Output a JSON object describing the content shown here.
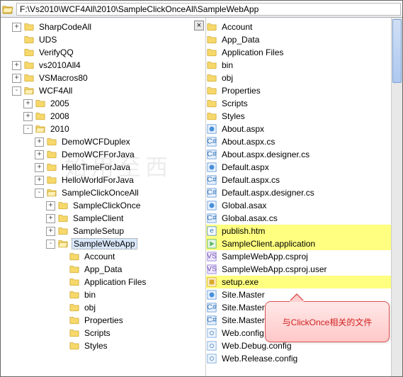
{
  "address": {
    "path": "F:\\Vs2010\\WCF4All\\2010\\SampleClickOnceAll\\SampleWebApp"
  },
  "tabClose": "×",
  "tree": [
    {
      "d": 1,
      "tw": "+",
      "ico": "folder",
      "label": "SharpCodeAll"
    },
    {
      "d": 1,
      "tw": "",
      "ico": "folder",
      "label": "UDS"
    },
    {
      "d": 1,
      "tw": "",
      "ico": "folder",
      "label": "VerifyQQ"
    },
    {
      "d": 1,
      "tw": "+",
      "ico": "folder",
      "label": "vs2010All4"
    },
    {
      "d": 1,
      "tw": "+",
      "ico": "folder",
      "label": "VSMacros80"
    },
    {
      "d": 1,
      "tw": "-",
      "ico": "folder-open",
      "label": "WCF4All"
    },
    {
      "d": 2,
      "tw": "+",
      "ico": "folder",
      "label": "2005"
    },
    {
      "d": 2,
      "tw": "+",
      "ico": "folder",
      "label": "2008"
    },
    {
      "d": 2,
      "tw": "-",
      "ico": "folder-open",
      "label": "2010"
    },
    {
      "d": 3,
      "tw": "+",
      "ico": "folder",
      "label": "DemoWCFDuplex"
    },
    {
      "d": 3,
      "tw": "+",
      "ico": "folder",
      "label": "DemoWCFForJava"
    },
    {
      "d": 3,
      "tw": "+",
      "ico": "folder",
      "label": "HelloTimeForJava"
    },
    {
      "d": 3,
      "tw": "+",
      "ico": "folder",
      "label": "HelloWorldForJava"
    },
    {
      "d": 3,
      "tw": "-",
      "ico": "folder-open",
      "label": "SampleClickOnceAll"
    },
    {
      "d": 4,
      "tw": "+",
      "ico": "folder",
      "label": "SampleClickOnce"
    },
    {
      "d": 4,
      "tw": "+",
      "ico": "folder",
      "label": "SampleClient"
    },
    {
      "d": 4,
      "tw": "+",
      "ico": "folder",
      "label": "SampleSetup"
    },
    {
      "d": 4,
      "tw": "-",
      "ico": "folder-open",
      "label": "SampleWebApp",
      "sel": true
    },
    {
      "d": 5,
      "tw": "",
      "ico": "folder",
      "label": "Account"
    },
    {
      "d": 5,
      "tw": "",
      "ico": "folder",
      "label": "App_Data"
    },
    {
      "d": 5,
      "tw": "",
      "ico": "folder",
      "label": "Application Files"
    },
    {
      "d": 5,
      "tw": "",
      "ico": "folder",
      "label": "bin"
    },
    {
      "d": 5,
      "tw": "",
      "ico": "folder",
      "label": "obj"
    },
    {
      "d": 5,
      "tw": "",
      "ico": "folder",
      "label": "Properties"
    },
    {
      "d": 5,
      "tw": "",
      "ico": "folder",
      "label": "Scripts"
    },
    {
      "d": 5,
      "tw": "",
      "ico": "folder",
      "label": "Styles"
    }
  ],
  "files": [
    {
      "ico": "folder",
      "label": "Account"
    },
    {
      "ico": "folder",
      "label": "App_Data"
    },
    {
      "ico": "folder",
      "label": "Application Files"
    },
    {
      "ico": "folder",
      "label": "bin"
    },
    {
      "ico": "folder",
      "label": "obj"
    },
    {
      "ico": "folder",
      "label": "Properties"
    },
    {
      "ico": "folder",
      "label": "Scripts"
    },
    {
      "ico": "folder",
      "label": "Styles"
    },
    {
      "ico": "aspx",
      "label": "About.aspx"
    },
    {
      "ico": "cs",
      "label": "About.aspx.cs"
    },
    {
      "ico": "cs",
      "label": "About.aspx.designer.cs"
    },
    {
      "ico": "aspx",
      "label": "Default.aspx"
    },
    {
      "ico": "cs",
      "label": "Default.aspx.cs"
    },
    {
      "ico": "cs",
      "label": "Default.aspx.designer.cs"
    },
    {
      "ico": "asax",
      "label": "Global.asax"
    },
    {
      "ico": "cs",
      "label": "Global.asax.cs"
    },
    {
      "ico": "htm",
      "label": "publish.htm",
      "hl": true
    },
    {
      "ico": "app",
      "label": "SampleClient.application",
      "hl": true
    },
    {
      "ico": "proj",
      "label": "SampleWebApp.csproj"
    },
    {
      "ico": "proj",
      "label": "SampleWebApp.csproj.user"
    },
    {
      "ico": "exe",
      "label": "setup.exe",
      "hl": true
    },
    {
      "ico": "master",
      "label": "Site.Master"
    },
    {
      "ico": "cs",
      "label": "Site.Master"
    },
    {
      "ico": "cs",
      "label": "Site.Master"
    },
    {
      "ico": "config",
      "label": "Web.config"
    },
    {
      "ico": "config",
      "label": "Web.Debug.config"
    },
    {
      "ico": "config",
      "label": "Web.Release.config"
    }
  ],
  "callout": "与ClickOnce相关的文件",
  "watermark": "始用至西"
}
